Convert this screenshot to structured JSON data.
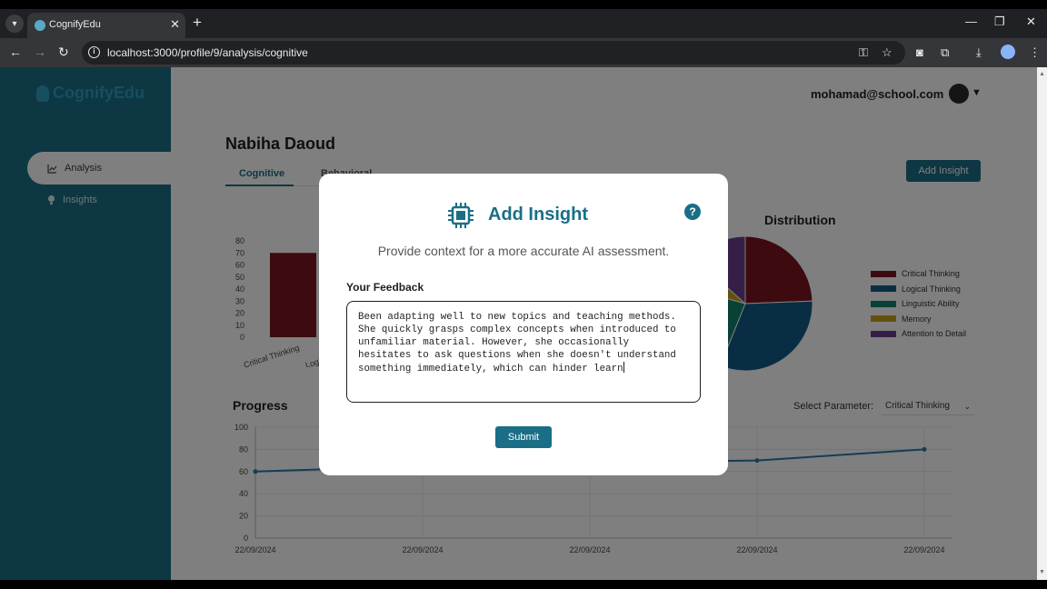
{
  "browser": {
    "tab_title": "CognifyEdu",
    "tab_close": "✕",
    "new_tab": "+",
    "url": "localhost:3000/profile/9/analysis/cognitive",
    "minimize": "—",
    "maximize": "❐",
    "close": "✕"
  },
  "sidebar": {
    "logo": "CognifyEdu",
    "items": [
      {
        "label": "Analysis",
        "icon": "chart-line-icon"
      },
      {
        "label": "Insights",
        "icon": "lightbulb-icon"
      }
    ]
  },
  "header": {
    "email": "mohamad@school.com"
  },
  "page": {
    "student_name": "Nabiha Daoud",
    "tabs": [
      {
        "label": "Cognitive"
      },
      {
        "label": "Behavioral"
      }
    ],
    "add_insight_label": "Add Insight"
  },
  "colors": {
    "primary": "#1a6f86",
    "critical_thinking": "#7b1420",
    "logical_thinking": "#125d86",
    "linguistic_ability": "#10826d",
    "memory": "#c8a018",
    "attention_to_detail": "#6a3e8f"
  },
  "chart_data": [
    {
      "type": "bar",
      "categories": [
        "Critical Thinking",
        "Logical Thinking"
      ],
      "values": [
        70,
        null
      ],
      "title": "",
      "xlabel": "",
      "ylabel": "",
      "ylim": [
        0,
        80
      ],
      "yticks": [
        "0",
        "10",
        "20",
        "30",
        "40",
        "50",
        "60",
        "70",
        "80"
      ]
    },
    {
      "type": "pie",
      "title": "Distribution",
      "labels": [
        "Critical Thinking",
        "Logical Thinking",
        "Linguistic Ability",
        "Memory",
        "Attention to Detail"
      ],
      "values": [
        20,
        26,
        19,
        6,
        11
      ],
      "legend": "right"
    },
    {
      "type": "line",
      "title": "Progress",
      "x": [
        "22/09/2024",
        "22/09/2024",
        "22/09/2024",
        "22/09/2024",
        "22/09/2024"
      ],
      "series": [
        {
          "values": [
            60,
            65,
            68,
            70,
            80
          ]
        }
      ],
      "ylim": [
        0,
        100
      ],
      "yticks": [
        "0",
        "20",
        "40",
        "60",
        "80",
        "100"
      ],
      "grid": true
    }
  ],
  "progress": {
    "select_label": "Select Parameter:",
    "selected_parameter": "Critical Thinking"
  },
  "modal": {
    "title": "Add Insight",
    "help": "?",
    "subtitle": "Provide context for a more accurate AI assessment.",
    "feedback_label": "Your Feedback",
    "feedback_text": "Been adapting well to new topics and teaching methods.\nShe quickly grasps complex concepts when introduced to\nunfamiliar material. However, she occasionally\nhesitates to ask questions when she doesn't understand\nsomething immediately, which can hinder learn",
    "submit_label": "Submit"
  }
}
